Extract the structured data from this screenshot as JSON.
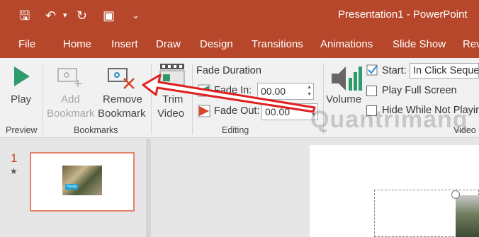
{
  "app": {
    "title": "Presentation1  -  PowerPoint"
  },
  "quick_access": {
    "icons": [
      "save-icon",
      "undo-icon",
      "dropdown-icon",
      "redo-icon",
      "present-icon",
      "customize-icon"
    ],
    "save": "🖫",
    "undo": "↶",
    "undo_drop": "▾",
    "repeat": "↻",
    "present": "▣",
    "customize": "⌄"
  },
  "tabs": [
    "File",
    "Home",
    "Insert",
    "Draw",
    "Design",
    "Transitions",
    "Animations",
    "Slide Show",
    "Rev"
  ],
  "ribbon": {
    "preview": {
      "play_label": "Play",
      "group_label": "Preview"
    },
    "bookmarks": {
      "add_line1": "Add",
      "add_line2": "Bookmark",
      "remove_line1": "Remove",
      "remove_line2": "Bookmark",
      "group_label": "Bookmarks"
    },
    "editing": {
      "trim_line1": "Trim",
      "trim_line2": "Video",
      "fade_duration_label": "Fade Duration",
      "fade_in_label": "Fade In:",
      "fade_in_value": "00.00",
      "fade_out_label": "Fade Out:",
      "fade_out_value": "00.00",
      "group_label": "Editing"
    },
    "video_options": {
      "volume_label": "Volume",
      "start_label": "Start:",
      "start_value": "In Click Sequence",
      "play_full_screen_label": "Play Full Screen",
      "hide_while_not_playing_label": "Hide While Not Playing",
      "group_label": "Video"
    }
  },
  "slides_panel": {
    "slide_number": "1",
    "star": "★",
    "thumb_tag": "Panda"
  },
  "watermark": "Quantrimang",
  "colors": {
    "title_bar": "#b7472a",
    "ribbon": "#f1f1f1",
    "annotation_arrow": "#e02020"
  }
}
